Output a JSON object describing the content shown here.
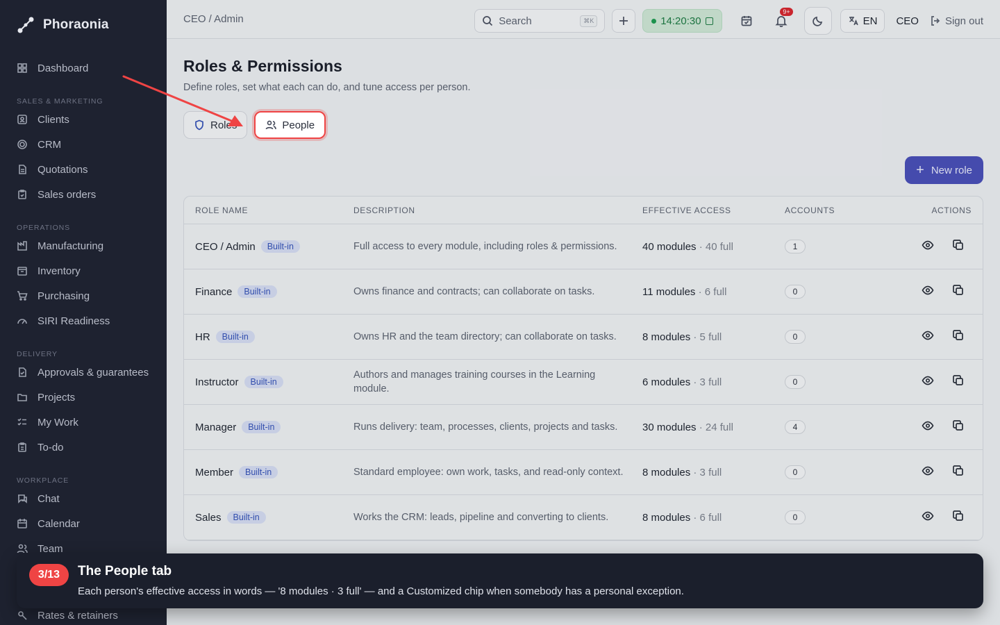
{
  "app": {
    "name": "Phoraonia"
  },
  "sidebar": {
    "top": [
      {
        "label": "Dashboard",
        "icon": "grid-icon"
      }
    ],
    "sections": [
      {
        "title": "SALES & MARKETING",
        "items": [
          {
            "label": "Clients",
            "icon": "user-card-icon"
          },
          {
            "label": "CRM",
            "icon": "target-icon"
          },
          {
            "label": "Quotations",
            "icon": "document-icon"
          },
          {
            "label": "Sales orders",
            "icon": "clipboard-icon"
          }
        ]
      },
      {
        "title": "OPERATIONS",
        "items": [
          {
            "label": "Manufacturing",
            "icon": "factory-icon"
          },
          {
            "label": "Inventory",
            "icon": "box-icon"
          },
          {
            "label": "Purchasing",
            "icon": "cart-icon"
          },
          {
            "label": "SIRI Readiness",
            "icon": "gauge-icon"
          }
        ]
      },
      {
        "title": "DELIVERY",
        "items": [
          {
            "label": "Approvals & guarantees",
            "icon": "file-check-icon"
          },
          {
            "label": "Projects",
            "icon": "folder-icon"
          },
          {
            "label": "My Work",
            "icon": "list-check-icon"
          },
          {
            "label": "To-do",
            "icon": "clipboard-check-icon"
          }
        ]
      },
      {
        "title": "WORKPLACE",
        "items": [
          {
            "label": "Chat",
            "icon": "chat-icon"
          },
          {
            "label": "Calendar",
            "icon": "calendar-icon"
          },
          {
            "label": "Team",
            "icon": "users-icon"
          }
        ]
      }
    ],
    "bottom_partial": "Rates & retainers"
  },
  "topbar": {
    "breadcrumb": "CEO / Admin",
    "search_placeholder": "Search",
    "search_shortcut": "⌘K",
    "clock": "14:20:30",
    "notif_badge": "9+",
    "language": "EN",
    "role": "CEO",
    "signout": "Sign out"
  },
  "page": {
    "title": "Roles & Permissions",
    "subtitle": "Define roles, set what each can do, and tune access per person.",
    "tabs": [
      {
        "label": "Roles"
      },
      {
        "label": "People"
      }
    ],
    "new_role": "New role"
  },
  "table": {
    "headers": [
      "ROLE NAME",
      "DESCRIPTION",
      "EFFECTIVE ACCESS",
      "ACCOUNTS",
      "ACTIONS"
    ],
    "rows": [
      {
        "name": "CEO / Admin",
        "chip": "Built-in",
        "description": "Full access to every module, including roles & permissions.",
        "modules": "40 modules",
        "full": "· 40 full",
        "accounts": "1"
      },
      {
        "name": "Finance",
        "chip": "Built-in",
        "description": "Owns finance and contracts; can collaborate on tasks.",
        "modules": "11 modules",
        "full": "· 6 full",
        "accounts": "0"
      },
      {
        "name": "HR",
        "chip": "Built-in",
        "description": "Owns HR and the team directory; can collaborate on tasks.",
        "modules": "8 modules",
        "full": "· 5 full",
        "accounts": "0"
      },
      {
        "name": "Instructor",
        "chip": "Built-in",
        "description": "Authors and manages training courses in the Learning module.",
        "modules": "6 modules",
        "full": "· 3 full",
        "accounts": "0"
      },
      {
        "name": "Manager",
        "chip": "Built-in",
        "description": "Runs delivery: team, processes, clients, projects and tasks.",
        "modules": "30 modules",
        "full": "· 24 full",
        "accounts": "4"
      },
      {
        "name": "Member",
        "chip": "Built-in",
        "description": "Standard employee: own work, tasks, and read-only context.",
        "modules": "8 modules",
        "full": "· 3 full",
        "accounts": "0"
      },
      {
        "name": "Sales",
        "chip": "Built-in",
        "description": "Works the CRM: leads, pipeline and converting to clients.",
        "modules": "8 modules",
        "full": "· 6 full",
        "accounts": "0"
      }
    ]
  },
  "tour": {
    "step": "3/13",
    "title": "The People tab",
    "body": "Each person's effective access in words — '8 modules · 3 full' — and a Customized chip when somebody has a personal exception."
  },
  "colors": {
    "accent": "#4a4fb8",
    "highlight": "#ef4444",
    "sidebar": "#1e2230"
  }
}
